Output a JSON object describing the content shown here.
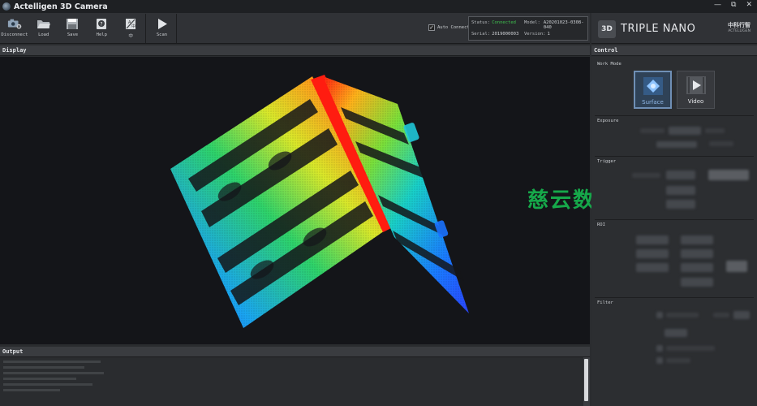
{
  "window": {
    "title": "Actelligen 3D Camera",
    "controls": [
      "—",
      "⧉",
      "✕"
    ]
  },
  "toolbar": {
    "buttons": [
      {
        "label": "Disconnect",
        "icon": "camera-icon"
      },
      {
        "label": "Load",
        "icon": "folder-open-icon"
      },
      {
        "label": "Save",
        "icon": "save-icon"
      },
      {
        "label": "Help",
        "icon": "help-icon"
      },
      {
        "label": "中",
        "icon": "language-icon"
      },
      {
        "label": "Scan",
        "icon": "play-icon"
      }
    ],
    "auto_connect": {
      "label": "Auto Connect",
      "checked": true
    }
  },
  "status": {
    "status_label": "Status:",
    "status_value": "Connected",
    "model_label": "Model:",
    "model_value": "A20201023-0308-040",
    "serial_label": "Serial:",
    "serial_value": "2019000003",
    "version_label": "Version:",
    "version_value": "1"
  },
  "brand": {
    "badge": "3D",
    "product": "TRIPLE NANO",
    "maker_cn": "中科行智",
    "maker_en": "ACTELLIGEN"
  },
  "display": {
    "title": "Display"
  },
  "output": {
    "title": "Output"
  },
  "control": {
    "title": "Control",
    "work_mode": {
      "title": "Work Mode",
      "modes": [
        {
          "label": "Surface",
          "active": true
        },
        {
          "label": "Video",
          "active": false
        }
      ]
    },
    "sections": {
      "exposure": "Exposure",
      "trigger": "Trigger",
      "roi": "ROI",
      "filter": "Filter"
    }
  },
  "watermark": "慈云数据",
  "colors": {
    "connected": "#3fc04f",
    "accent": "#6f8fb5",
    "watermark": "#16a84a"
  }
}
